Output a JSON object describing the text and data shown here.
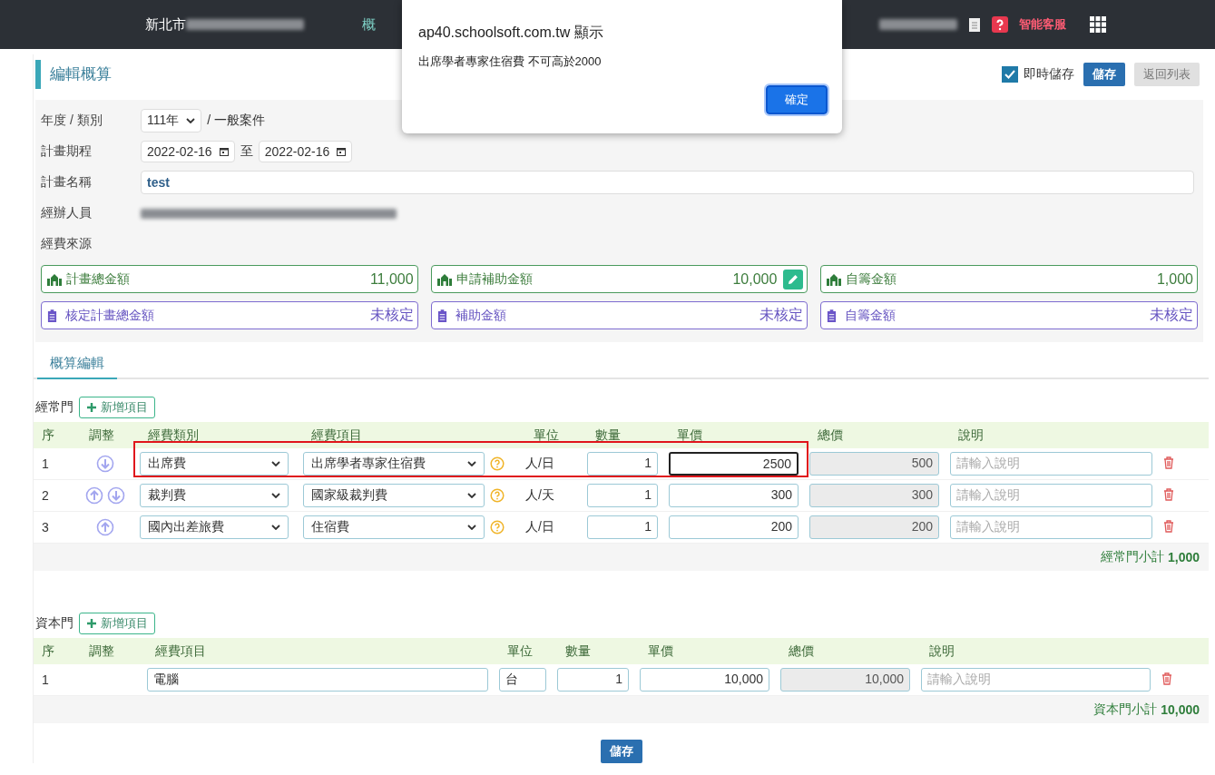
{
  "topbar": {
    "city": "新北市",
    "menu_fragment": "概",
    "help_label": "智能客服"
  },
  "header": {
    "title": "編輯概算",
    "autosave": {
      "label": "即時儲存",
      "checked": true
    },
    "save": "儲存",
    "back": "返回列表"
  },
  "form": {
    "year_label": "年度 / 類別",
    "year_value": "111年",
    "category": "/ 一般案件",
    "period_label": "計畫期程",
    "start": "2022-02-16",
    "to": "至",
    "end": "2022-02-16",
    "name_label": "計畫名稱",
    "name_value": "test",
    "staff_label": "經辦人員",
    "source_label": "經費來源"
  },
  "funding": [
    {
      "label": "計畫總金額",
      "value": "11,000",
      "editable": false
    },
    {
      "label": "申請補助金額",
      "value": "10,000",
      "editable": true
    },
    {
      "label": "自籌金額",
      "value": "1,000",
      "editable": false
    }
  ],
  "approved": [
    {
      "label": "核定計畫總金額",
      "value": "未核定"
    },
    {
      "label": "補助金額",
      "value": "未核定"
    },
    {
      "label": "自籌金額",
      "value": "未核定"
    }
  ],
  "tabs": [
    {
      "label": "概算編輯",
      "selected": true
    }
  ],
  "recurrent": {
    "title": "經常門",
    "add": "新增項目",
    "columns": [
      "序",
      "調整",
      "經費類別",
      "經費項目",
      "單位",
      "數量",
      "單價",
      "總價",
      "說明"
    ],
    "rows": [
      {
        "seq": "1",
        "move_up": false,
        "move_down": true,
        "category": "出席費",
        "item": "出席學者專家住宿費",
        "unit": "人/日",
        "qty": "1",
        "price": "2500",
        "total": "500",
        "placeholder": "請輸入說明",
        "focused": true,
        "highlighted": true
      },
      {
        "seq": "2",
        "move_up": true,
        "move_down": true,
        "category": "裁判費",
        "item": "國家級裁判費",
        "unit": "人/天",
        "qty": "1",
        "price": "300",
        "total": "300",
        "placeholder": "請輸入說明",
        "focused": false,
        "highlighted": false
      },
      {
        "seq": "3",
        "move_up": true,
        "move_down": false,
        "category": "國內出差旅費",
        "item": "住宿費",
        "unit": "人/日",
        "qty": "1",
        "price": "200",
        "total": "200",
        "placeholder": "請輸入說明",
        "focused": false,
        "highlighted": false
      }
    ],
    "subtotal_label": "經常門小計",
    "subtotal": "1,000"
  },
  "capital": {
    "title": "資本門",
    "add": "新增項目",
    "columns": [
      "序",
      "調整",
      "經費項目",
      "單位",
      "數量",
      "單價",
      "總價",
      "說明"
    ],
    "rows": [
      {
        "seq": "1",
        "item": "電腦",
        "unit": "台",
        "qty": "1",
        "price": "10,000",
        "total": "10,000",
        "placeholder": "請輸入說明"
      }
    ],
    "subtotal_label": "資本門小計",
    "subtotal": "10,000"
  },
  "footer_save": "儲存",
  "dialog": {
    "title": "ap40.schoolsoft.com.tw 顯示",
    "message": "出席學者專家住宿費 不可高於2000",
    "ok": "確定"
  }
}
